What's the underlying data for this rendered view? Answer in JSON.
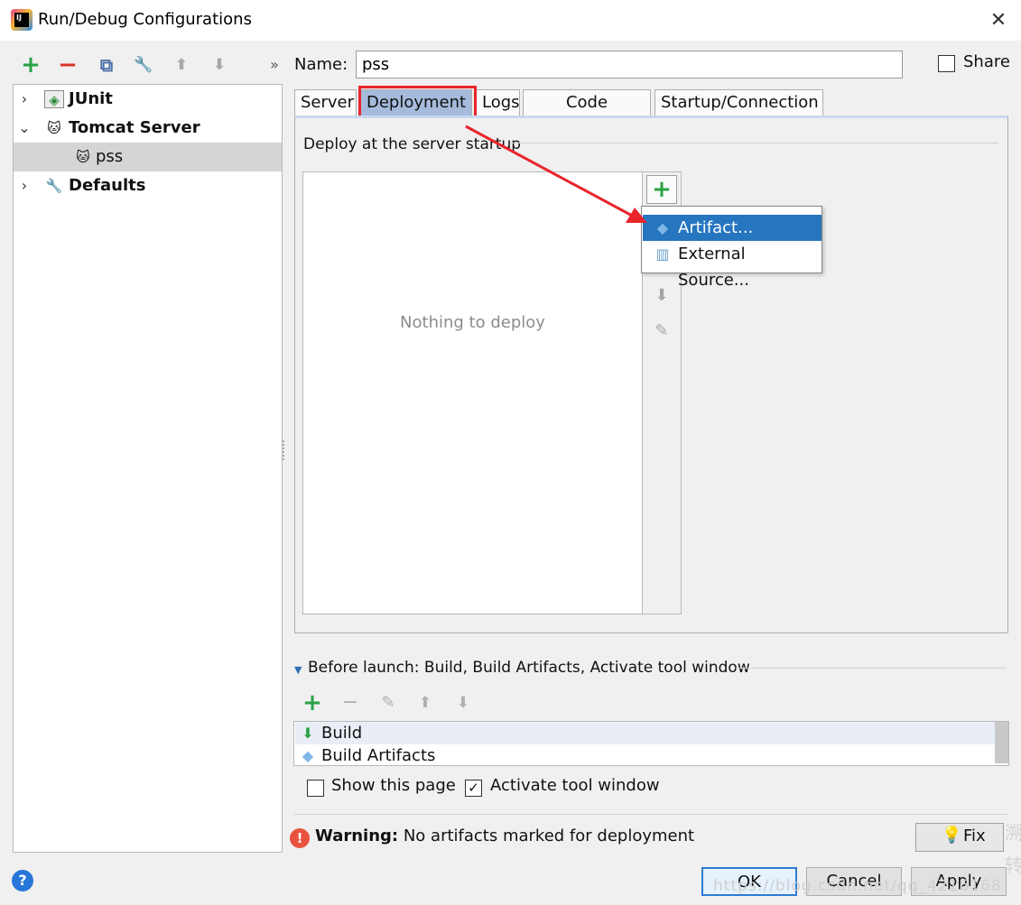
{
  "window": {
    "title": "Run/Debug Configurations",
    "close_glyph": "✕",
    "app_icon_text": "IJ"
  },
  "toolbar": {
    "icons": [
      {
        "name": "add-icon",
        "glyph": "+",
        "color": "#2aa245"
      },
      {
        "name": "remove-icon",
        "glyph": "−",
        "color": "#d9332b"
      },
      {
        "name": "copy-icon",
        "glyph": "⧉",
        "color": "#4a6fa5"
      },
      {
        "name": "wrench-icon",
        "glyph": "🔧",
        "color": "#555555"
      },
      {
        "name": "arrow-up-icon",
        "glyph": "⬆",
        "color": "#a8a8a8"
      },
      {
        "name": "arrow-down-icon",
        "glyph": "⬇",
        "color": "#a8a8a8"
      }
    ],
    "more_glyph": "»"
  },
  "tree": {
    "items": [
      {
        "label": "JUnit",
        "chevron": "›",
        "icon": "junit-icon",
        "icon_glyph": "◈"
      },
      {
        "label": "Tomcat Server",
        "chevron": "⌄",
        "icon": "tomcat-icon",
        "icon_glyph": "🐱"
      },
      {
        "label": "pss",
        "icon": "tomcat-config-icon",
        "icon_glyph": "🐱",
        "selected": true
      },
      {
        "label": "Defaults",
        "chevron": "›",
        "icon": "wrench-icon",
        "icon_glyph": "🔧"
      }
    ]
  },
  "name_field": {
    "label": "Name:",
    "value": "pss"
  },
  "share": {
    "label": "Share",
    "checked": false
  },
  "tabs": [
    {
      "label": "Server"
    },
    {
      "label": "Deployment",
      "active": true
    },
    {
      "label": "Logs"
    },
    {
      "label": "Code Coverage"
    },
    {
      "label": "Startup/Connection"
    }
  ],
  "deployment": {
    "section_label": "Deploy at the server startup",
    "empty_text": "Nothing to deploy",
    "side_buttons": {
      "add": "+",
      "down": "⬇",
      "edit": "✎"
    },
    "popup": [
      {
        "label": "Artifact...",
        "icon": "artifact-icon",
        "icon_glyph": "◆",
        "selected": true
      },
      {
        "label": "External Source...",
        "icon": "external-source-icon",
        "icon_glyph": "▥"
      }
    ]
  },
  "before_launch": {
    "label": "Before launch: Build, Build Artifacts, Activate tool window",
    "toolbar": [
      {
        "name": "add-icon",
        "glyph": "+",
        "color": "#2aa245"
      },
      {
        "name": "remove-icon",
        "glyph": "−",
        "color": "#b0b0b0"
      },
      {
        "name": "edit-icon",
        "glyph": "✎",
        "color": "#b0b0b0"
      },
      {
        "name": "arrow-up-icon",
        "glyph": "⬆",
        "color": "#b0b0b0"
      },
      {
        "name": "arrow-down-icon",
        "glyph": "⬇",
        "color": "#b0b0b0"
      }
    ],
    "tasks": [
      {
        "label": "Build",
        "icon": "build-icon",
        "icon_glyph": "⬇"
      },
      {
        "label": "Build Artifacts",
        "icon": "artifact-icon",
        "icon_glyph": "◆"
      }
    ],
    "show_page": {
      "label": "Show this page",
      "checked": false
    },
    "activate_tool": {
      "label": "Activate tool window",
      "checked": true
    }
  },
  "warning": {
    "prefix": "Warning:",
    "text": " No artifacts marked for deployment"
  },
  "buttons": {
    "fix": "Fix",
    "ok": "OK",
    "cancel": "Cancel",
    "apply": "Apply",
    "help": "?"
  },
  "watermark": {
    "url": "https://blog.csdn.net/qq_4216168",
    "side_chars": [
      "溯",
      "转"
    ]
  },
  "colors": {
    "accent": "#2675bf",
    "tab_active": "#a6bbdc",
    "highlight": "#e8252b",
    "plus_green": "#2aa245"
  }
}
